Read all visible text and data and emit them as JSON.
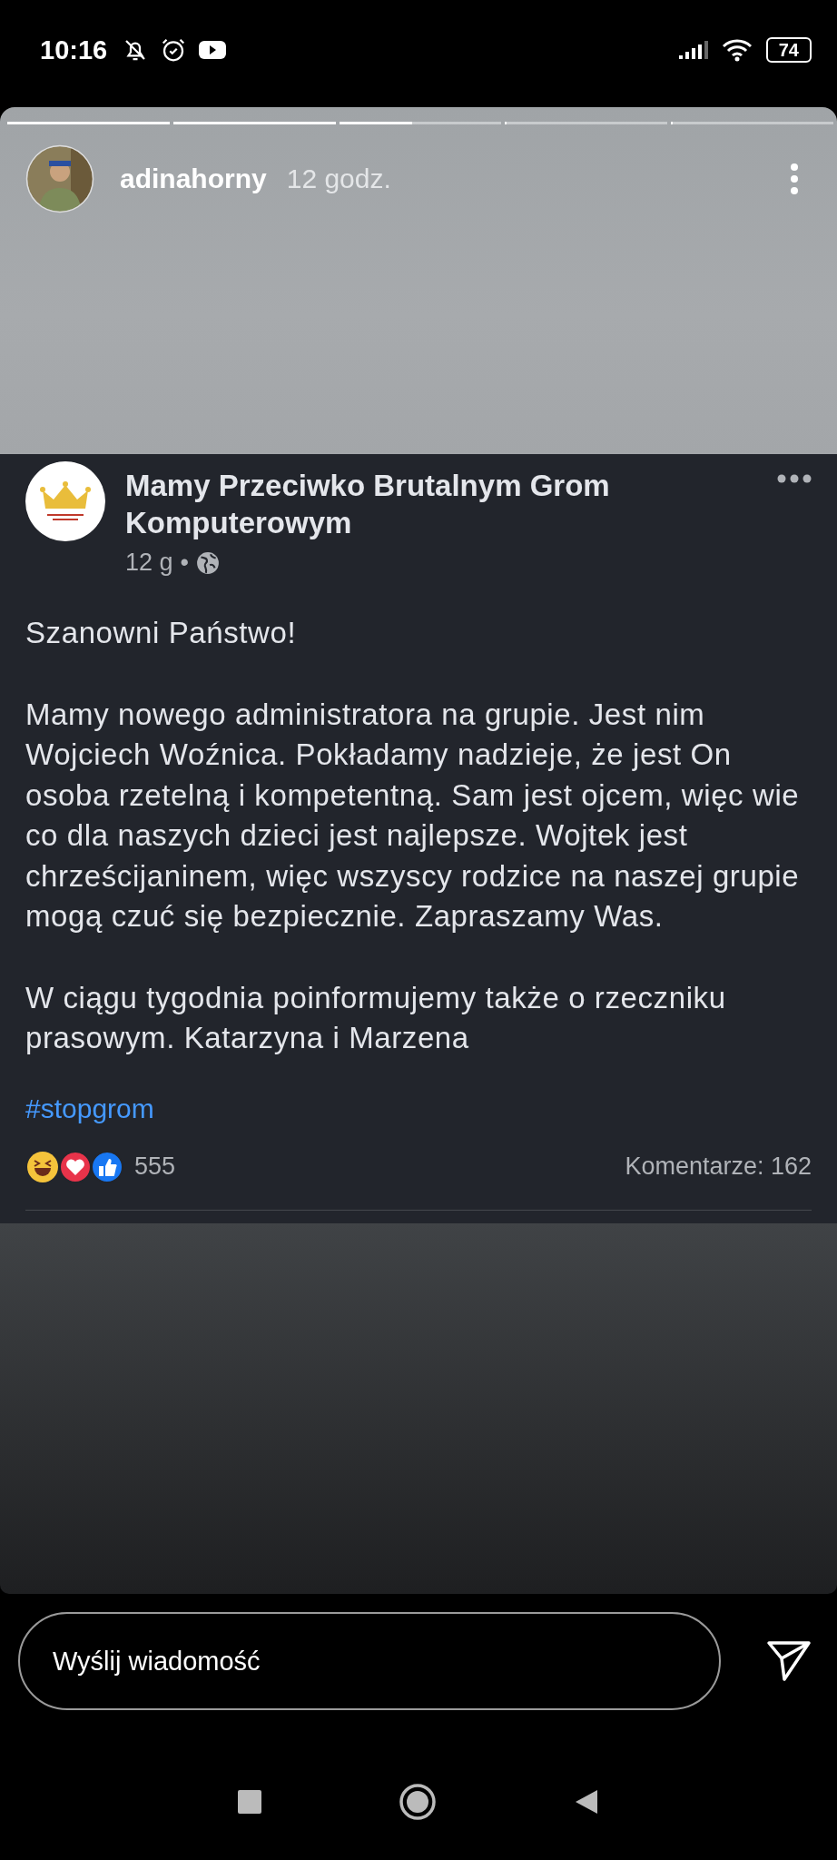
{
  "status_bar": {
    "time": "10:16",
    "battery": "74"
  },
  "story": {
    "progress": [
      {
        "level": 1
      },
      {
        "level": 1
      },
      {
        "level": 0.45
      },
      {
        "level": 0
      },
      {
        "level": 0
      }
    ],
    "username": "adinahorny",
    "age": "12 godz."
  },
  "post": {
    "group": "Mamy Przeciwko Brutalnym Grom Komputerowym",
    "time": "12 g",
    "separator": "•",
    "paragraphs": [
      "Szanowni Państwo!",
      "Mamy nowego administratora na grupie. Jest nim Wojciech Woźnica. Pokładamy nadzieje, że jest On osoba rzetelną i kompetentną. Sam jest ojcem, więc wie co dla naszych dzieci jest najlepsze. Wojtek jest chrześcijaninem, więc wszyscy rodzice na naszej grupie mogą czuć się bezpiecznie. Zapraszamy Was.",
      "W ciągu tygodnia poinformujemy także o rzeczniku prasowym. Katarzyna i Marzena"
    ],
    "hashtag": "#stopgrom",
    "reactions": "555",
    "comments": "Komentarze: 162"
  },
  "message_field": {
    "placeholder": "Wyślij wiadomość"
  }
}
